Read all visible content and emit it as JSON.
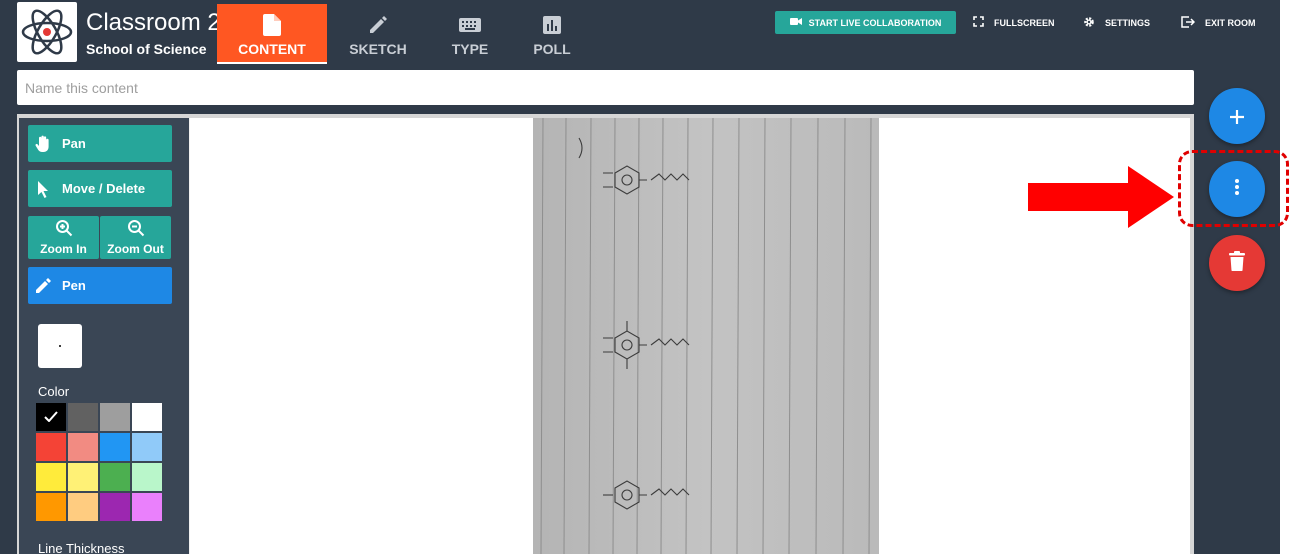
{
  "header": {
    "room_title": "Classroom 2",
    "school": "School of Science",
    "tabs": [
      {
        "label": "CONTENT",
        "icon": "file-icon",
        "active": true
      },
      {
        "label": "SKETCH",
        "icon": "pencil-icon",
        "active": false
      },
      {
        "label": "TYPE",
        "icon": "keyboard-icon",
        "active": false
      },
      {
        "label": "POLL",
        "icon": "bar-chart-icon",
        "active": false
      }
    ],
    "live_collab": "START LIVE COLLABORATION",
    "fullscreen": "FULLSCREEN",
    "settings": "SETTINGS",
    "exit_room": "EXIT ROOM"
  },
  "content_name": {
    "placeholder": "Name this content",
    "value": ""
  },
  "toolbar": {
    "pan": "Pan",
    "move_delete": "Move / Delete",
    "zoom_in": "Zoom In",
    "zoom_out": "Zoom Out",
    "pen": "Pen",
    "color_label": "Color",
    "selected_color": "#000000",
    "colors": [
      "#000000",
      "#616161",
      "#9e9e9e",
      "#ffffff",
      "#f44336",
      "#f28b82",
      "#2196f3",
      "#90caf9",
      "#ffeb3b",
      "#fff176",
      "#4caf50",
      "#b9f6ca",
      "#ff9800",
      "#ffcc80",
      "#9c27b0",
      "#ea80fc"
    ],
    "line_thickness_label": "Line Thickness"
  },
  "colors": {
    "header_bg": "#2f3a48",
    "active_tab": "#ff5722",
    "teal": "#26a69a",
    "blue": "#1e88e5",
    "red": "#e53935",
    "annotation_red": "#ff0000"
  }
}
